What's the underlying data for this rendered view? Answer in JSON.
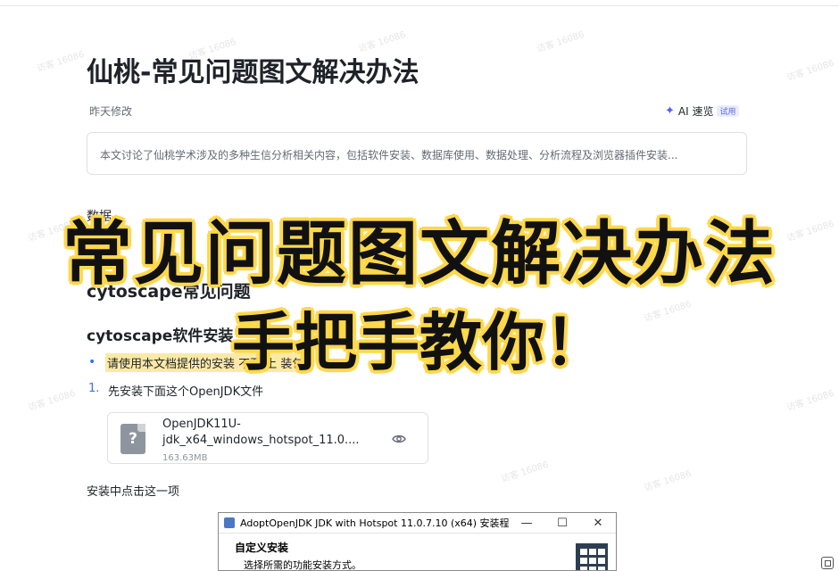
{
  "doc": {
    "title": "仙桃-常见问题图文解决办法",
    "modified": "昨天修改",
    "ai_label": "AI 速览",
    "ai_badge": "试用",
    "summary": "本文讨论了仙桃学术涉及的多种生信分析相关内容，包括软件安装、数据库使用、数据处理、分析流程及浏览器插件安装..."
  },
  "rows": {
    "row1": "数据",
    "row2": "回资"
  },
  "section": {
    "h2": "cytoscape常见问题",
    "h3": "cytoscape软件安装",
    "bullet_text": "请使用本文档提供的安装      不要      上      装包",
    "step1_num": "1.",
    "step1_text": "先安装下面这个OpenJDK文件"
  },
  "file": {
    "name": "OpenJDK11U-jdk_x64_windows_hotspot_11.0....",
    "size": "163.63MB",
    "icon_glyph": "?"
  },
  "note": "安装中点击这一项",
  "dialog": {
    "title": "AdoptOpenJDK JDK with Hotspot 11.0.7.10 (x64) 安装程序",
    "minimize": "—",
    "maximize": "☐",
    "close": "✕",
    "heading": "自定义安装",
    "subheading": "选择所需的功能安装方式。"
  },
  "overlay": {
    "line1": "常见问题图文解决办法",
    "line2": "手把手教你！"
  },
  "watermark": "访客 16086",
  "colors": {
    "accent": "#3370ff",
    "highlight": "#fbe9a6",
    "overlay_stroke": "#ffd84a"
  }
}
